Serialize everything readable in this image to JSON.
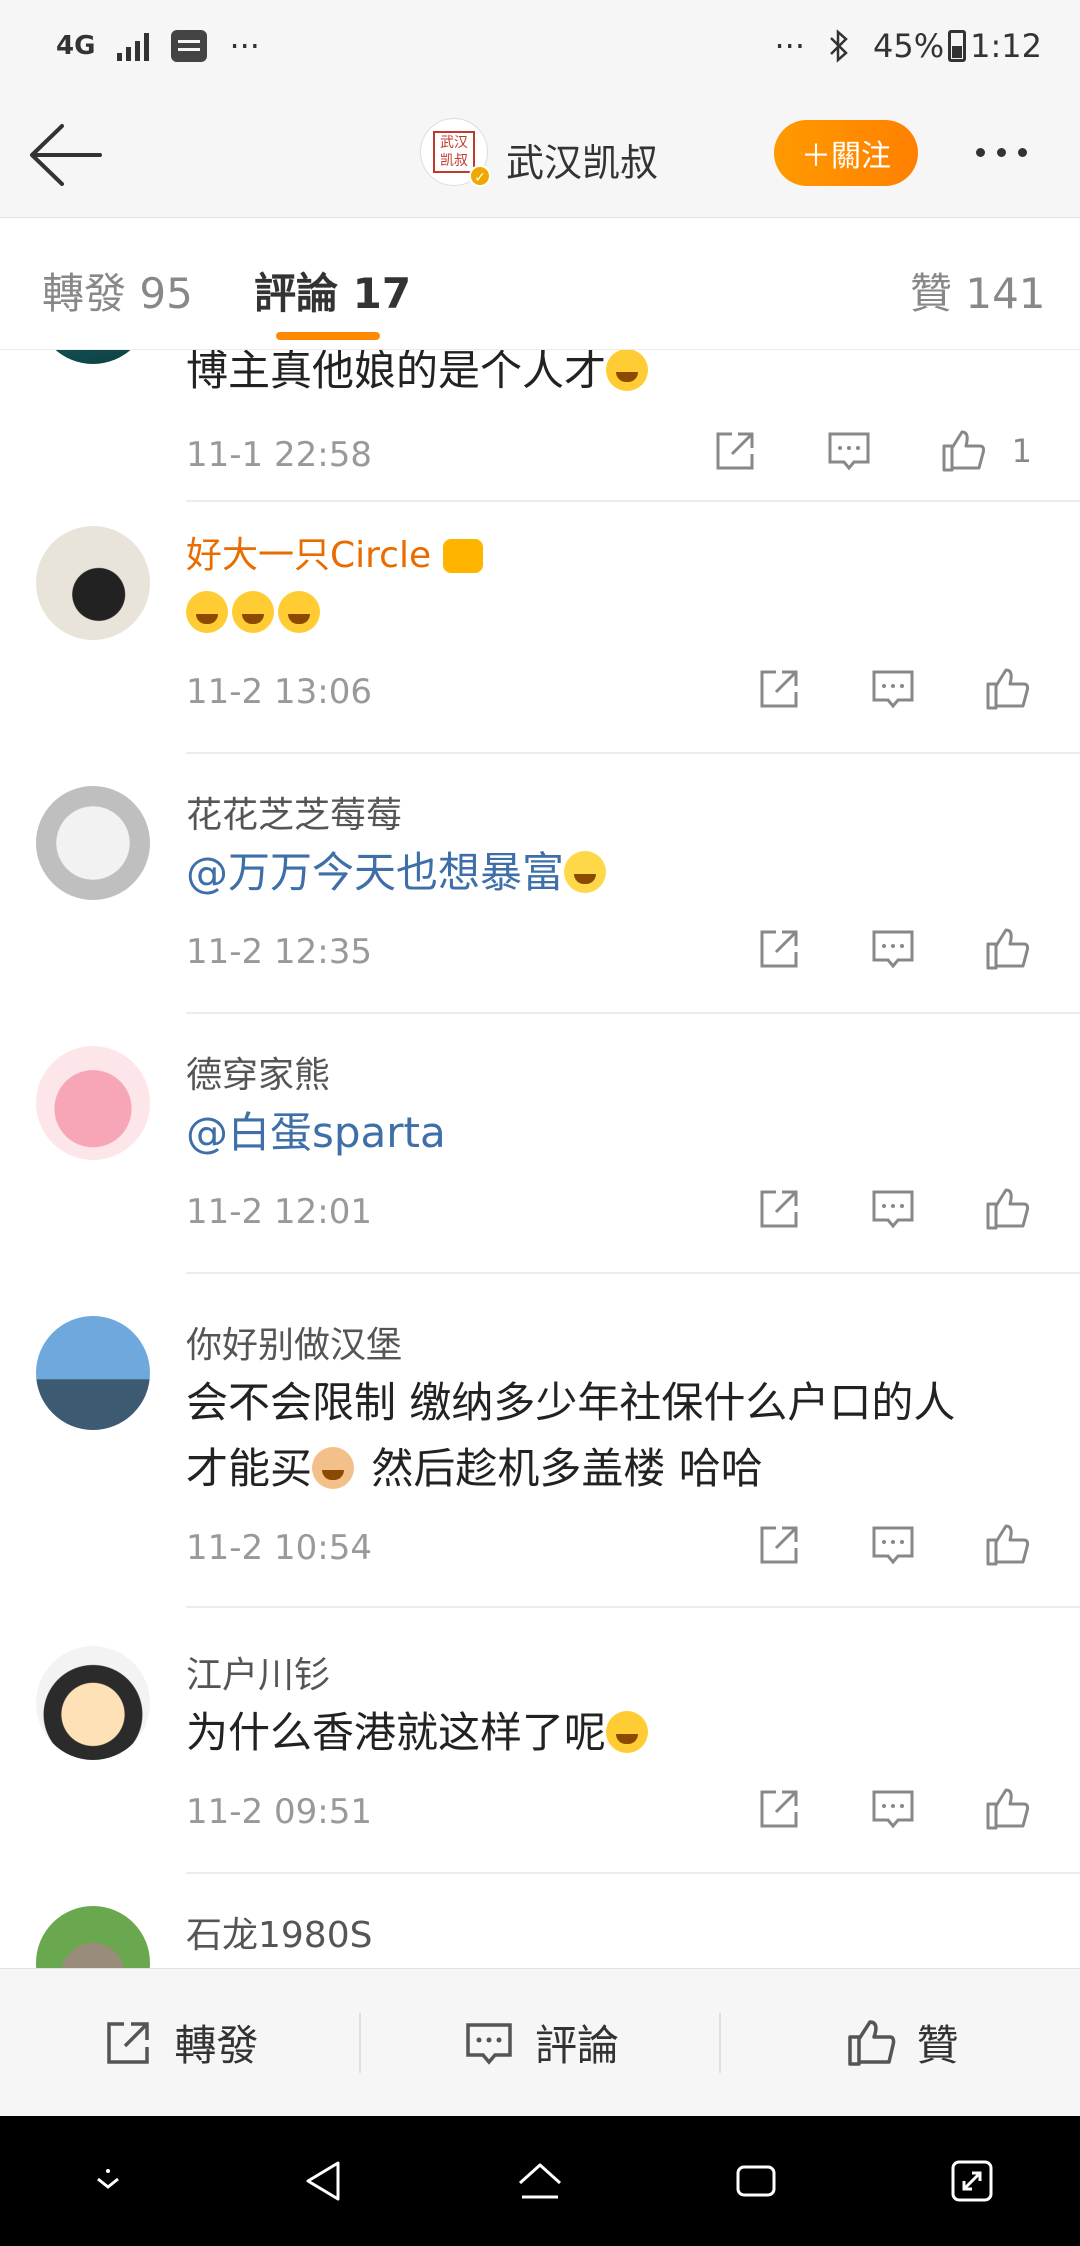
{
  "status_bar": {
    "network": "4G",
    "dots_left": "···",
    "dots_right": "···",
    "battery": "45%",
    "time": "1:12"
  },
  "nav": {
    "title": "武汉凯叔",
    "logo_text": "武汉凯叔",
    "follow_label": "＋關注"
  },
  "tabs": {
    "repost": "轉發 95",
    "comments": "評論 17",
    "likes": "贊 141"
  },
  "comments": [
    {
      "name": "",
      "text": "博主真他娘的是个人才",
      "time": "11-1 22:58",
      "likes": "1"
    },
    {
      "name": "好大一只Circle",
      "text": "",
      "time": "11-2 13:06",
      "likes": ""
    },
    {
      "name": "花花芝芝莓莓",
      "text": "@万万今天也想暴富",
      "time": "11-2 12:35",
      "likes": ""
    },
    {
      "name": "德穿家熊",
      "text": "@白蛋sparta",
      "time": "11-2 12:01",
      "likes": ""
    },
    {
      "name": "你好别做汉堡",
      "text": "会不会限制 缴纳多少年社保什么户口的人",
      "text2": "才能买",
      "text3": " 然后趁机多盖楼 哈哈",
      "time": "11-2 10:54",
      "likes": ""
    },
    {
      "name": "江户川钐",
      "text": "为什么香港就这样了呢",
      "time": "11-2 09:51",
      "likes": ""
    },
    {
      "name": "石龙1980S",
      "text": "",
      "time": "",
      "likes": ""
    }
  ],
  "bottom_bar": {
    "repost": "轉發",
    "comment": "評論",
    "like": "贊"
  },
  "colors": {
    "accent": "#ff8a00",
    "mention": "#3e6fa8",
    "vip_name": "#e86c00"
  },
  "icons": [
    "back-arrow-icon",
    "more-icon",
    "share-icon",
    "comment-icon",
    "like-icon",
    "sys-down-icon",
    "sys-back-icon",
    "sys-home-icon",
    "sys-recents-icon",
    "sys-expand-icon"
  ]
}
